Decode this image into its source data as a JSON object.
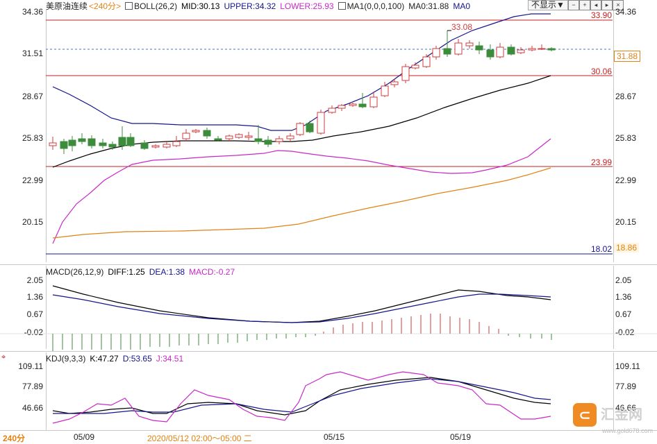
{
  "main": {
    "symbol": "美原油连续",
    "period": "<240分>",
    "boll": "BOLL(26,2)",
    "mid": "MID:30.13",
    "upper": "UPPER:34.32",
    "lower": "LOWER:25.93",
    "ma": "MA1(0,0,0,100)",
    "ma0": "MA0:31.88",
    "ma0b": "MA0",
    "hide_btn": "不显示▼",
    "y_ticks": [
      "34.36",
      "31.51",
      "28.67",
      "25.83",
      "22.99",
      "20.15"
    ],
    "level_lines": {
      "l1": "33.90",
      "l2": "30.06",
      "l3": "23.99",
      "l4": "18.02"
    },
    "current_price": "31.88",
    "ma_value_tag": "18.86",
    "high_label": "33.08"
  },
  "macd": {
    "title": "MACD(26,12,9)",
    "diff": "DIFF:1.25",
    "dea": "DEA:1.38",
    "macd": "MACD:-0.27",
    "y_ticks": [
      "2.05",
      "1.36",
      "0.67",
      "-0.02"
    ]
  },
  "kdj": {
    "title": "KDJ(9,3,3)",
    "k": "K:47.27",
    "d": "D:53.65",
    "j": "J:34.51",
    "y_ticks": [
      "109.11",
      "77.89",
      "46.66"
    ]
  },
  "footer": {
    "period": "240分",
    "dates": [
      "05/09",
      "05/15",
      "05/19"
    ],
    "cursor_time": "2020/05/12 02:00～05:00 二"
  },
  "brand": {
    "name": "汇金网",
    "site": "www.gold678.com",
    "icon": "brand-logo-icon"
  },
  "colors": {
    "up": "#d23c3c",
    "down": "#3c8c3c",
    "upper": "#14148c",
    "mid": "#000000",
    "lower": "#c828c8",
    "ma": "#e08214",
    "level": "#c81e1e"
  }
}
